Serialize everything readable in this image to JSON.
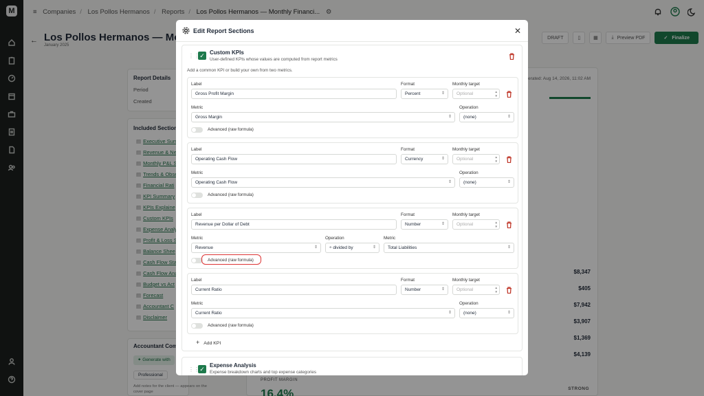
{
  "app": {
    "logo": "M"
  },
  "rail": {
    "icons": [
      "home-icon",
      "clipboard-icon",
      "gauge-icon",
      "calendar-icon",
      "briefcase-icon",
      "report-icon",
      "document-icon",
      "users-icon",
      "user-icon",
      "help-icon"
    ]
  },
  "breadcrumb": {
    "items": [
      "Companies",
      "Los Pollos Hermanos",
      "Reports",
      "Los Pollos Hermanos — Monthly Financi..."
    ],
    "separator": "/"
  },
  "page": {
    "title": "Los Pollos Hermanos — Month",
    "date": "January 2025",
    "status_badge": "DRAFT",
    "preview_label": "Preview PDF",
    "finalize_label": "Finalize"
  },
  "report_details": {
    "title": "Report Details",
    "period_label": "Period",
    "created_label": "Created"
  },
  "included_sections": {
    "title": "Included Section",
    "items": [
      "Executive Sum",
      "Revenue & Ne",
      "Monthly P&L S",
      "Trends & Obse",
      "Financial Rati",
      "KPI Summary",
      "KPIs Explaine",
      "Custom KPIs",
      "Expense Analy",
      "Profit & Loss S",
      "Balance Shee",
      "Cash Flow Sta",
      "Cash Flow Ana",
      "Budget vs Act",
      "Forecast",
      "Accountant C",
      "Disclaimer"
    ]
  },
  "accountant": {
    "title": "Accountant Com",
    "generate_label": "Generate with",
    "tone": "Professional",
    "notes_hint_1": "Add notes for the client — appears on the",
    "notes_hint_2": "cover page"
  },
  "right_panel": {
    "generated": "erated: Aug 14, 2026, 11:02 AM",
    "amounts": [
      "$8,347",
      "$405",
      "$7,942",
      "$3,907",
      "$1,369",
      "$4,139"
    ],
    "profit_margin_label": "PROFIT MARGIN",
    "profit_margin_value": "16.4%",
    "strength": "STRONG"
  },
  "modal": {
    "title": "Edit Report Sections",
    "custom_kpis": {
      "title": "Custom KPIs",
      "description": "User-defined KPIs whose values are computed from report metrics",
      "hint": "Add a common KPI or build your own from two metrics.",
      "labels": {
        "label": "Label",
        "format": "Format",
        "monthly_target": "Monthly target",
        "metric": "Metric",
        "operation": "Operation",
        "advanced": "Advanced (raw formula)",
        "target_placeholder": "Optional"
      },
      "kpis": [
        {
          "label": "Gross Profit Margin",
          "format": "Percent",
          "metric": "Gross Margin",
          "operation": "(none)"
        },
        {
          "label": "Operating Cash Flow",
          "format": "Currency",
          "metric": "Operating Cash Flow",
          "operation": "(none)"
        },
        {
          "label": "Revenue per Dollar of Debt",
          "format": "Number",
          "metric": "Revenue",
          "operation": "÷ divided by",
          "metric2": "Total Liabilities"
        },
        {
          "label": "Current Ratio",
          "format": "Number",
          "metric": "Current Ratio",
          "operation": "(none)"
        }
      ],
      "add_label": "Add KPI"
    },
    "expense_analysis": {
      "title": "Expense Analysis",
      "description": "Expense breakdown charts and top expense categories"
    }
  },
  "colors": {
    "accent": "#1e7a4c",
    "danger": "#c0392b",
    "highlight": "#d33333"
  }
}
